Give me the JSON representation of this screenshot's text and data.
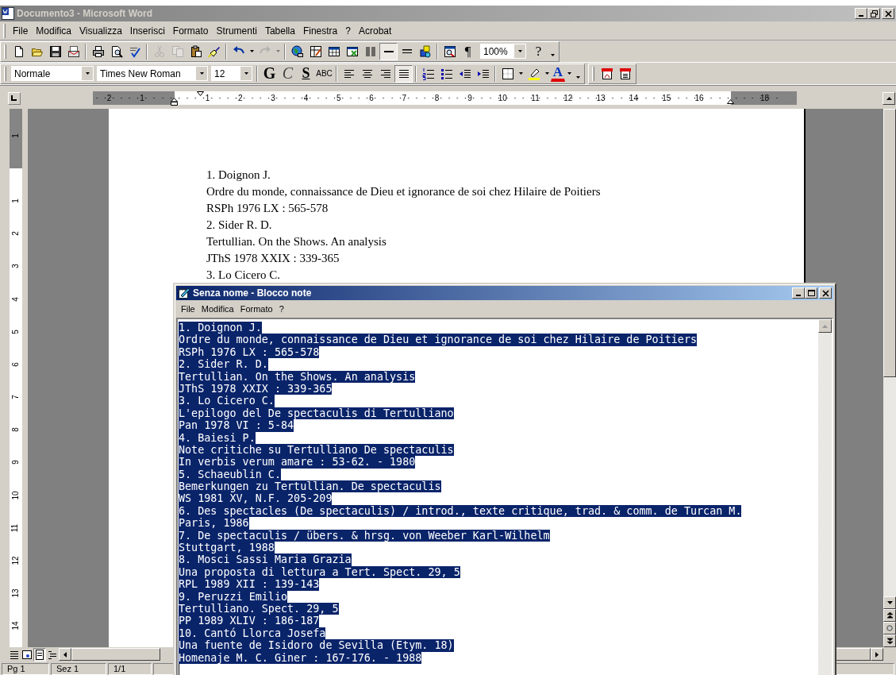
{
  "word_window": {
    "title": "Documento3 - Microsoft Word",
    "active": false
  },
  "word_menu": [
    "File",
    "Modifica",
    "Visualizza",
    "Inserisci",
    "Formato",
    "Strumenti",
    "Tabella",
    "Finestra",
    "?",
    "Acrobat"
  ],
  "standard_toolbar": {
    "zoom": "100%",
    "buttons": [
      {
        "pressed": false,
        "disabled": false
      },
      {
        "pressed": false,
        "disabled": false
      },
      {
        "pressed": false,
        "disabled": false
      },
      {
        "pressed": false,
        "disabled": false
      },
      {
        "pressed": false,
        "disabled": false
      },
      {
        "pressed": false,
        "disabled": false
      },
      {
        "pressed": false,
        "disabled": false
      },
      {
        "pressed": false,
        "disabled": true
      },
      {
        "pressed": false,
        "disabled": true
      },
      {
        "pressed": false,
        "disabled": false
      },
      {
        "pressed": false,
        "disabled": false
      },
      {
        "pressed": false,
        "disabled": false
      },
      {
        "pressed": false,
        "disabled": true
      },
      {
        "pressed": false,
        "disabled": false
      },
      {
        "pressed": false,
        "disabled": false
      },
      {
        "pressed": false,
        "disabled": false
      },
      {
        "pressed": false,
        "disabled": false
      },
      {
        "pressed": false,
        "disabled": false
      },
      {
        "pressed": true,
        "disabled": false
      },
      {
        "pressed": false,
        "disabled": false
      },
      {
        "pressed": false,
        "disabled": false
      },
      {
        "pressed": false,
        "disabled": false
      },
      {
        "label": "¶",
        "pressed": false,
        "disabled": false
      },
      {
        "label": "?",
        "pressed": false,
        "disabled": false
      }
    ]
  },
  "formatting_toolbar": {
    "style": "Normale",
    "font": "Times New Roman",
    "size": "12",
    "buttons": [
      {
        "label": "G",
        "pressed": false
      },
      {
        "label": "C",
        "pressed": false
      },
      {
        "label": "S",
        "pressed": false
      },
      {
        "label": "ABC",
        "pressed": false
      },
      {
        "pressed": false
      },
      {
        "pressed": false
      },
      {
        "pressed": false
      },
      {
        "pressed": true
      },
      {
        "pressed": false
      },
      {
        "pressed": false
      },
      {
        "pressed": false
      },
      {
        "pressed": false
      },
      {
        "pressed": false
      },
      {
        "pressed": false
      },
      {
        "label": "A",
        "pressed": false
      },
      {
        "pressed": false
      },
      {
        "pressed": false
      }
    ]
  },
  "horizontal_ruler": {
    "labels": [
      "2",
      "1",
      "1",
      "2",
      "3",
      "4",
      "5",
      "6",
      "7",
      "8",
      "9",
      "10",
      "11",
      "12",
      "13",
      "14",
      "15",
      "16",
      "18"
    ]
  },
  "vertical_ruler": {
    "labels": [
      "1",
      "1",
      "2",
      "3",
      "4",
      "5",
      "6",
      "7",
      "8",
      "9",
      "10",
      "11",
      "12",
      "13",
      "14"
    ]
  },
  "document": {
    "lines": [
      "1. Doignon J.",
      "Ordre du monde, connaissance de Dieu et ignorance de soi chez Hilaire de Poitiers",
      "RSPh 1976 LX : 565-578",
      "2. Sider R. D.",
      "Tertullian. On the Shows. An analysis",
      "JThS 1978 XXIX : 339-365",
      "3. Lo Cicero C."
    ]
  },
  "view_buttons": [
    {
      "selected": false
    },
    {
      "selected": false
    },
    {
      "selected": true
    },
    {
      "selected": false
    }
  ],
  "status_bar": [
    "Pg 1",
    "Sez 1",
    "1/1"
  ],
  "notepad": {
    "title": "Senza nome - Blocco note",
    "active": true,
    "menu": [
      "File",
      "Modifica",
      "Formato",
      "?"
    ],
    "text": {
      "selected": true,
      "lines": [
        "1. Doignon J.",
        "Ordre du monde, connaissance de Dieu et ignorance de soi chez Hilaire de Poitiers",
        "RSPh 1976 LX : 565-578",
        "2. Sider R. D.",
        "Tertullian. On the Shows. An analysis",
        "JThS 1978 XXIX : 339-365",
        "3. Lo Cicero C.",
        "L'epilogo del De spectaculis di Tertulliano",
        "Pan 1978 VI : 5-84",
        "4. Baiesi P.",
        "Note critiche su Tertulliano De spectaculis",
        "In verbis verum amare : 53-62. - 1980",
        "5. Schaeublin C.",
        "Bemerkungen zu Tertullian. De spectaculis",
        "WS 1981 XV, N.F. 205-209",
        "6. Des spectacles (De spectaculis) / introd., texte critique, trad. & comm. de Turcan M.",
        "Paris, 1986",
        "7. De spectaculis / übers. & hrsg. von Weeber Karl-Wilhelm",
        "Stuttgart, 1988",
        "8. Mosci Sassi Maria Grazia",
        "Una proposta di lettura a Tert. Spect. 29, 5",
        "RPL 1989 XII : 139-143",
        "9. Peruzzi Emilio",
        "Tertulliano. Spect. 29, 5",
        "PP 1989 XLIV : 186-187",
        "10. Cantó Llorca Josefa",
        "Una fuente de Isidoro de Sevilla (Etym. 18)",
        "Homenaje M. C. Giner : 167-176. - 1988"
      ]
    }
  }
}
